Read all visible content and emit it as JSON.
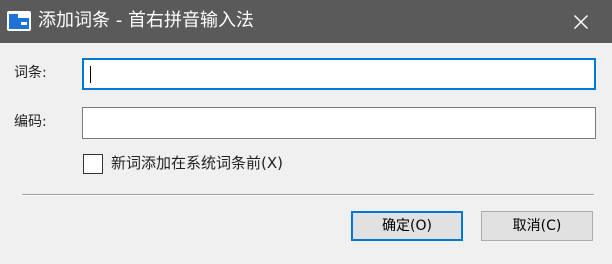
{
  "window": {
    "title": "添加词条 - 首右拼音输入法",
    "icon": "app-folder-icon",
    "close_icon": "close-icon",
    "titlebar_color": "#5a5a5a",
    "accent_color": "#0078d7"
  },
  "form": {
    "entry_label": "词条:",
    "entry_value": "",
    "code_label": "编码:",
    "code_value": "",
    "checkbox_label": "新词添加在系统词条前(X)",
    "checkbox_checked": false
  },
  "buttons": {
    "ok_label": "确定(O)",
    "cancel_label": "取消(C)"
  }
}
